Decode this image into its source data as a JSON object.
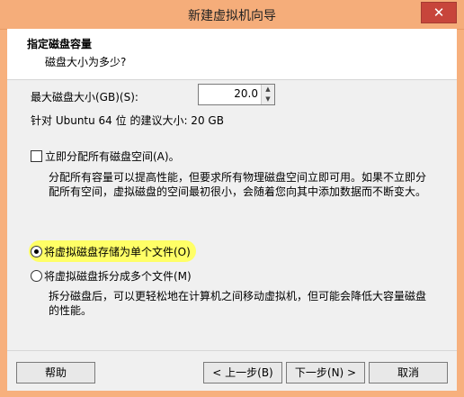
{
  "window": {
    "title": "新建虚拟机向导",
    "close_label": "✕"
  },
  "header": {
    "title": "指定磁盘容量",
    "subtitle": "磁盘大小为多少?"
  },
  "disk": {
    "max_size_label": "最大磁盘大小(GB)(S):",
    "max_size_value": "20.0",
    "recommend_text": "针对 Ubuntu 64 位 的建议大小: 20 GB"
  },
  "allocate": {
    "checkbox_label": "立即分配所有磁盘空间(A)。",
    "checked": false,
    "description": "分配所有容量可以提高性能，但要求所有物理磁盘空间立即可用。如果不立即分配所有空间，虚拟磁盘的空间最初很小，会随着您向其中添加数据而不断变大。"
  },
  "storage": {
    "single_file_label": "将虚拟磁盘存储为单个文件(O)",
    "multi_file_label": "将虚拟磁盘拆分成多个文件(M)",
    "selected": "single",
    "multi_description": "拆分磁盘后，可以更轻松地在计算机之间移动虚拟机，但可能会降低大容量磁盘的性能。"
  },
  "footer": {
    "help_label": "帮助",
    "back_label": "< 上一步(B)",
    "next_label": "下一步(N) >",
    "cancel_label": "取消"
  },
  "colors": {
    "title_bg": "#f5ad7a",
    "close_bg": "#c7453b",
    "highlight": "#ffff66"
  }
}
